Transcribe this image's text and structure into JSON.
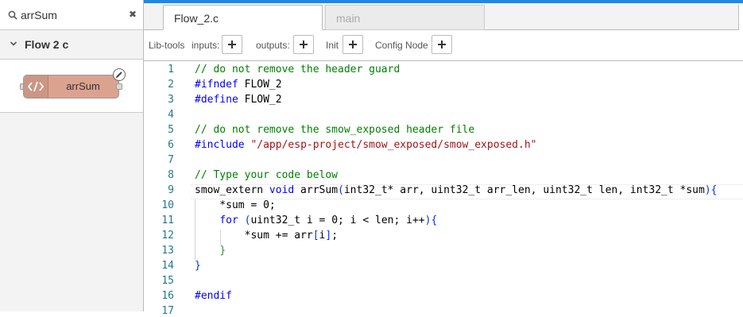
{
  "search": {
    "value": "arrSum",
    "clear_label": "✖"
  },
  "palette": {
    "category_title": "Flow 2 c",
    "node": {
      "label": "arrSum",
      "color": "#dba28f"
    }
  },
  "tabs": [
    {
      "label": "Flow_2.c",
      "active": true
    },
    {
      "label": "main",
      "active": false
    }
  ],
  "toolbar": {
    "libtools": "Lib-tools",
    "inputs": "inputs:",
    "outputs": "outputs:",
    "init": "Init",
    "config": "Config Node"
  },
  "editor": {
    "current_line": 9,
    "lines": [
      {
        "n": "1",
        "code": "// do not remove the header guard"
      },
      {
        "n": "2",
        "code": "#ifndef FLOW_2"
      },
      {
        "n": "3",
        "code": "#define FLOW_2"
      },
      {
        "n": "4",
        "code": ""
      },
      {
        "n": "5",
        "code": "// do not remove the smow_exposed header file"
      },
      {
        "n": "6",
        "code": "#include \"/app/esp-project/smow_exposed/smow_exposed.h\""
      },
      {
        "n": "7",
        "code": ""
      },
      {
        "n": "8",
        "code": "// Type your code below"
      },
      {
        "n": "9",
        "code": "smow_extern void arrSum(int32_t* arr, uint32_t arr_len, uint32_t len, int32_t *sum){"
      },
      {
        "n": "10",
        "code": "    *sum = 0;"
      },
      {
        "n": "11",
        "code": "    for (uint32_t i = 0; i < len; i++){"
      },
      {
        "n": "12",
        "code": "        *sum += arr[i];"
      },
      {
        "n": "13",
        "code": "    }"
      },
      {
        "n": "14",
        "code": "}"
      },
      {
        "n": "15",
        "code": ""
      },
      {
        "n": "16",
        "code": "#endif"
      },
      {
        "n": "17",
        "code": ""
      }
    ]
  },
  "colors": {
    "accent": "#1e88e5",
    "comment": "#008000",
    "keyword": "#0000ff",
    "string": "#a31515",
    "line_number": "#237893"
  }
}
